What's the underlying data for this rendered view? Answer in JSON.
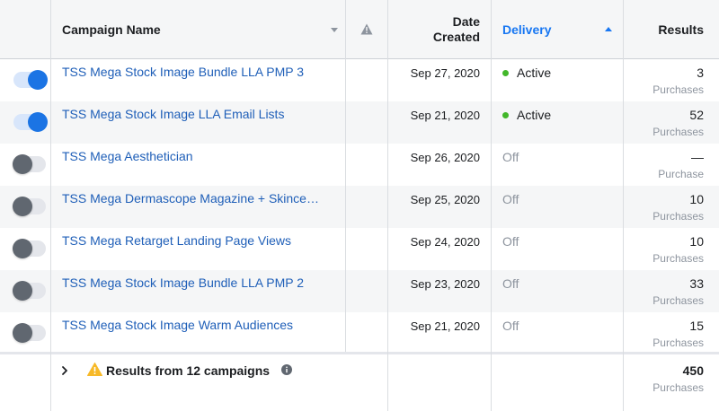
{
  "header": {
    "campaign_name": "Campaign Name",
    "date_created_line1": "Date",
    "date_created_line2": "Created",
    "delivery": "Delivery",
    "results": "Results"
  },
  "rows": [
    {
      "on": true,
      "name": "TSS Mega Stock Image Bundle LLA PMP 3",
      "date": "Sep 27, 2020",
      "delivery": "Active",
      "result": "3",
      "unit": "Purchases"
    },
    {
      "on": true,
      "name": "TSS Mega Stock Image LLA Email Lists",
      "date": "Sep 21, 2020",
      "delivery": "Active",
      "result": "52",
      "unit": "Purchases"
    },
    {
      "on": false,
      "name": "TSS Mega Aesthetician",
      "date": "Sep 26, 2020",
      "delivery": "Off",
      "result": "—",
      "unit": "Purchase"
    },
    {
      "on": false,
      "name": "TSS Mega Dermascope Magazine + Skince…",
      "date": "Sep 25, 2020",
      "delivery": "Off",
      "result": "10",
      "unit": "Purchases"
    },
    {
      "on": false,
      "name": "TSS Mega Retarget Landing Page Views",
      "date": "Sep 24, 2020",
      "delivery": "Off",
      "result": "10",
      "unit": "Purchases"
    },
    {
      "on": false,
      "name": "TSS Mega Stock Image Bundle LLA PMP 2",
      "date": "Sep 23, 2020",
      "delivery": "Off",
      "result": "33",
      "unit": "Purchases"
    },
    {
      "on": false,
      "name": "TSS Mega Stock Image Warm Audiences",
      "date": "Sep 21, 2020",
      "delivery": "Off",
      "result": "15",
      "unit": "Purchases"
    }
  ],
  "footer": {
    "label": "Results from 12 campaigns",
    "total": "450",
    "unit": "Purchases"
  },
  "colors": {
    "link": "#1f5fb8",
    "accent": "#1877f2",
    "active_dot": "#42b72a",
    "warning": "#f7b928"
  }
}
